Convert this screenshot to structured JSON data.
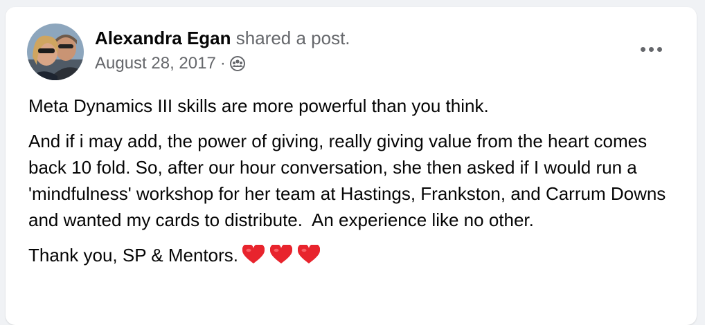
{
  "post": {
    "author": "Alexandra Egan",
    "action": " shared a post.",
    "date": "August 28, 2017",
    "separator": "·",
    "audience_icon": "friends-icon",
    "more_icon": "more-options-icon",
    "paragraphs": [
      "Meta Dynamics III skills are more powerful than you think.",
      "And if i may add, the power of giving, really giving value from the heart comes back 10 fold. So, after our hour conversation, she then asked if I would run a 'mindfulness' workshop for her team at Hastings, Frankston, and Carrum Downs and wanted my cards to distribute.  An experience like no other.",
      "Thank you, SP & Mentors."
    ],
    "emoji": [
      "heart-emoji",
      "heart-emoji",
      "heart-emoji"
    ]
  },
  "colors": {
    "heart": "#e8242d",
    "text": "#050505",
    "secondary": "#65676b"
  }
}
